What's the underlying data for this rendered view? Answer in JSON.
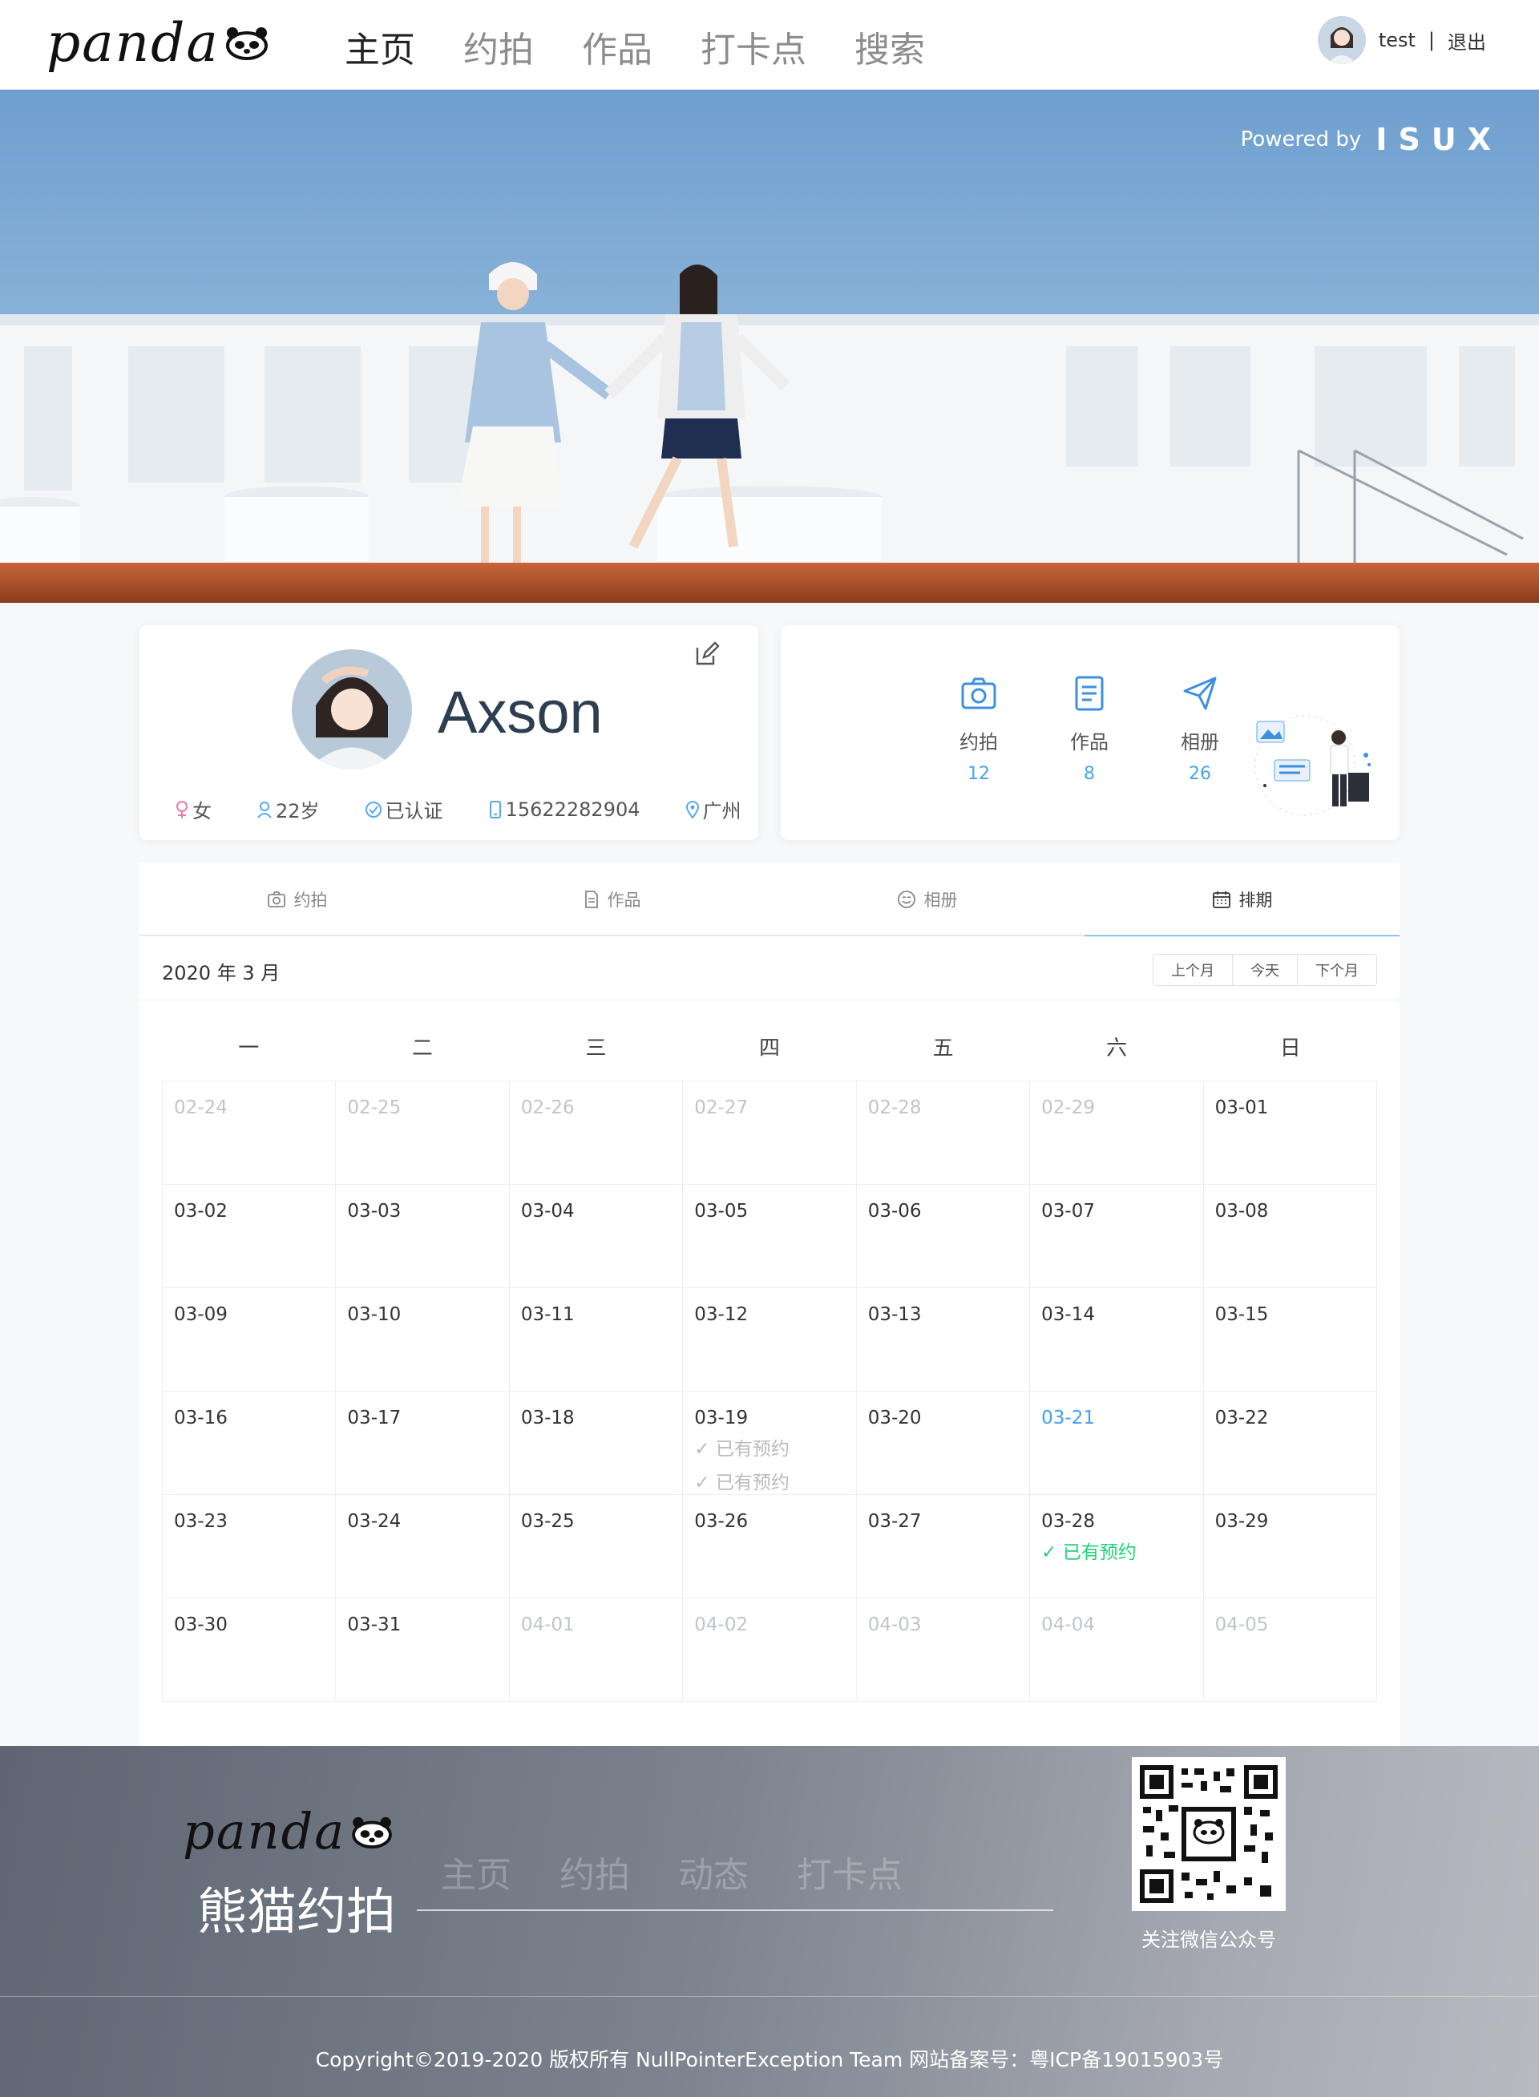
{
  "header": {
    "logo": "panda",
    "nav": [
      {
        "label": "主页",
        "active": true
      },
      {
        "label": "约拍",
        "active": false
      },
      {
        "label": "作品",
        "active": false
      },
      {
        "label": "打卡点",
        "active": false
      },
      {
        "label": "搜索",
        "active": false
      }
    ],
    "user": {
      "name": "test",
      "separator": "|",
      "logout": "退出"
    }
  },
  "banner": {
    "powered_by": "Powered by",
    "brand": "ISUX"
  },
  "profile": {
    "name": "Axson",
    "gender": "女",
    "age": "22岁",
    "verified": "已认证",
    "phone": "15622282904",
    "city": "广州"
  },
  "stats": [
    {
      "label": "约拍",
      "value": "12",
      "icon": "camera-icon"
    },
    {
      "label": "作品",
      "value": "8",
      "icon": "document-icon"
    },
    {
      "label": "相册",
      "value": "26",
      "icon": "paper-plane-icon"
    }
  ],
  "tabs": [
    {
      "label": "约拍",
      "icon": "camera-icon",
      "active": false
    },
    {
      "label": "作品",
      "icon": "document-icon",
      "active": false
    },
    {
      "label": "相册",
      "icon": "smile-icon",
      "active": false
    },
    {
      "label": "排期",
      "icon": "calendar-icon",
      "active": true
    }
  ],
  "calendar": {
    "title": "2020 年 3 月",
    "buttons": {
      "prev": "上个月",
      "today": "今天",
      "next": "下个月"
    },
    "weekdays": [
      "一",
      "二",
      "三",
      "四",
      "五",
      "六",
      "日"
    ],
    "cells": [
      {
        "date": "02-24",
        "other": true
      },
      {
        "date": "02-25",
        "other": true
      },
      {
        "date": "02-26",
        "other": true
      },
      {
        "date": "02-27",
        "other": true
      },
      {
        "date": "02-28",
        "other": true
      },
      {
        "date": "02-29",
        "other": true
      },
      {
        "date": "03-01"
      },
      {
        "date": "03-02"
      },
      {
        "date": "03-03"
      },
      {
        "date": "03-04"
      },
      {
        "date": "03-05"
      },
      {
        "date": "03-06"
      },
      {
        "date": "03-07"
      },
      {
        "date": "03-08"
      },
      {
        "date": "03-09"
      },
      {
        "date": "03-10"
      },
      {
        "date": "03-11"
      },
      {
        "date": "03-12"
      },
      {
        "date": "03-13"
      },
      {
        "date": "03-14"
      },
      {
        "date": "03-15"
      },
      {
        "date": "03-16"
      },
      {
        "date": "03-17"
      },
      {
        "date": "03-18"
      },
      {
        "date": "03-19",
        "bookings": [
          {
            "text": "✓ 已有预约",
            "style": "past"
          },
          {
            "text": "✓ 已有预约",
            "style": "past"
          }
        ]
      },
      {
        "date": "03-20"
      },
      {
        "date": "03-21",
        "today": true
      },
      {
        "date": "03-22"
      },
      {
        "date": "03-23"
      },
      {
        "date": "03-24"
      },
      {
        "date": "03-25"
      },
      {
        "date": "03-26"
      },
      {
        "date": "03-27"
      },
      {
        "date": "03-28",
        "bookings": [
          {
            "text": "✓ 已有预约",
            "style": "green"
          }
        ]
      },
      {
        "date": "03-29"
      },
      {
        "date": "03-30"
      },
      {
        "date": "03-31"
      },
      {
        "date": "04-01",
        "other": true
      },
      {
        "date": "04-02",
        "other": true
      },
      {
        "date": "04-03",
        "other": true
      },
      {
        "date": "04-04",
        "other": true
      },
      {
        "date": "04-05",
        "other": true
      }
    ]
  },
  "footer": {
    "logo": "panda",
    "brand": "熊猫约拍",
    "nav": [
      "主页",
      "约拍",
      "动态",
      "打卡点"
    ],
    "qr_label": "关注微信公众号",
    "copyright": "Copyright©2019-2020 版权所有 NullPointerException Team 网站备案号：粤ICP备19015903号"
  },
  "colors": {
    "accent": "#409eff",
    "stat_value": "#4aa3ee",
    "booking_green": "#1ed47a",
    "muted": "#c0c4cc"
  }
}
